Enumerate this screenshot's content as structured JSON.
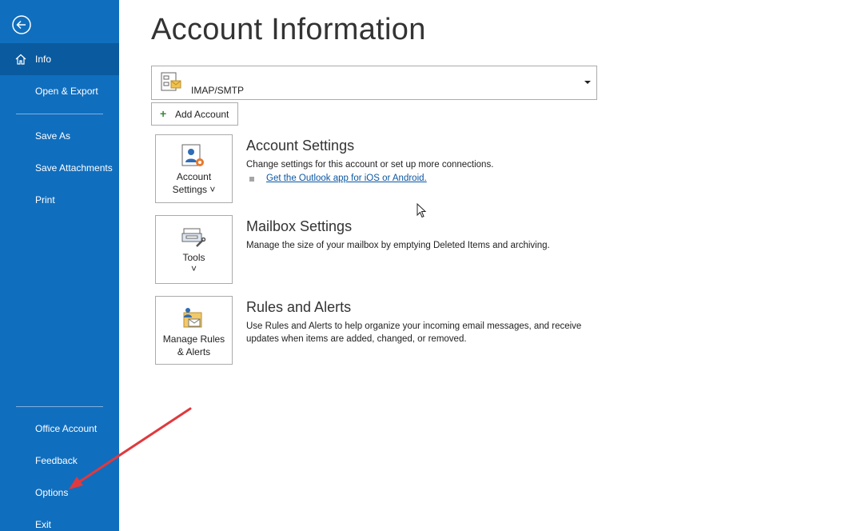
{
  "sidebar": {
    "items": [
      {
        "label": "Info"
      },
      {
        "label": "Open & Export"
      },
      {
        "label": "Save As"
      },
      {
        "label": "Save Attachments"
      },
      {
        "label": "Print"
      },
      {
        "label": "Office Account"
      },
      {
        "label": "Feedback"
      },
      {
        "label": "Options"
      },
      {
        "label": "Exit"
      }
    ]
  },
  "main": {
    "title": "Account Information",
    "account_selector": {
      "value": "IMAP/SMTP"
    },
    "add_account_label": "Add Account",
    "sections": [
      {
        "tile_label_1": "Account",
        "tile_label_2": "Settings ˅",
        "title": "Account Settings",
        "description": "Change settings for this account or set up more connections.",
        "link": "Get the Outlook app for iOS or Android."
      },
      {
        "tile_label_1": "Tools",
        "tile_label_2": "˅",
        "title": "Mailbox Settings",
        "description": "Manage the size of your mailbox by emptying Deleted Items and archiving."
      },
      {
        "tile_label_1": "Manage Rules",
        "tile_label_2": "& Alerts",
        "title": "Rules and Alerts",
        "description_line1": "Use Rules and Alerts to help organize your incoming email messages, and receive",
        "description_line2": "updates when items are added, changed, or removed."
      }
    ]
  },
  "colors": {
    "sidebar": "#106ebe",
    "sidebar_active": "#0a5a9f",
    "link": "#0b57a4",
    "annotation_arrow": "#e0393e"
  },
  "icons": [
    "back-arrow-icon",
    "home-icon",
    "account-card-icon",
    "plus-icon",
    "account-settings-icon",
    "tools-icon",
    "rules-alerts-icon",
    "mouse-cursor-icon"
  ]
}
